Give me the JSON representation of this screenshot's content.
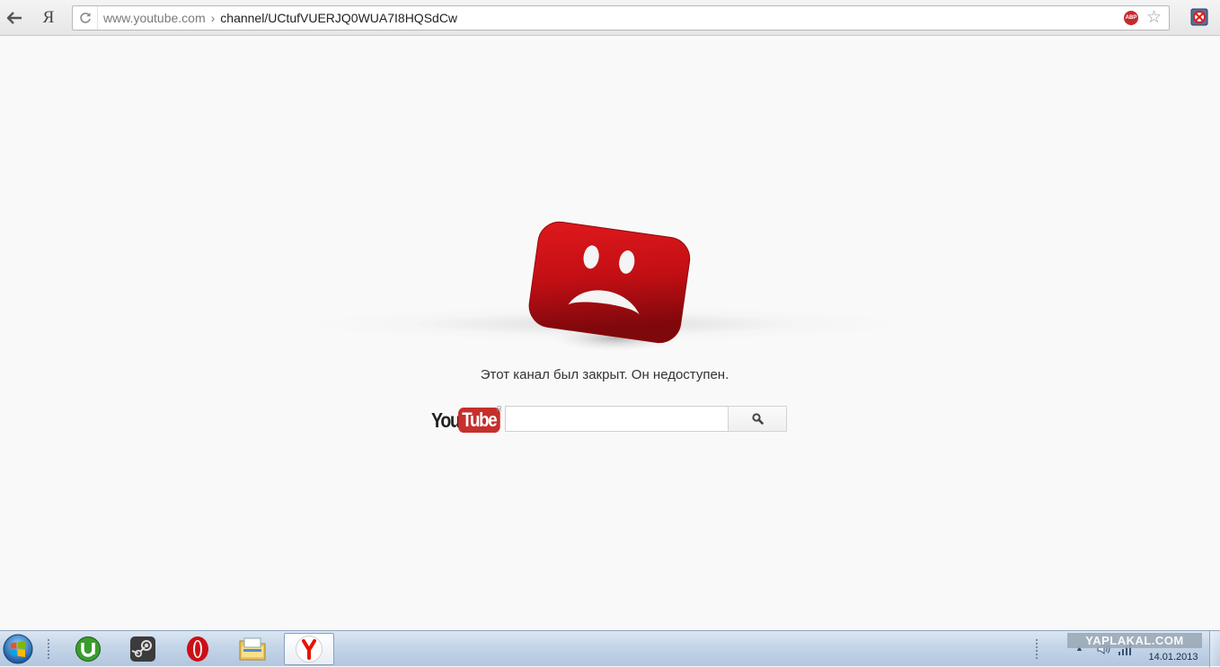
{
  "browser": {
    "address_host": "www.youtube.com",
    "address_separator": "›",
    "address_path": "channel/UCtufVUERJQ0WUA7I8HQSdCw",
    "yandex_button_label": "Я",
    "abp_label": "ABP"
  },
  "page": {
    "message": "Этот канал был закрыт. Он недоступен.",
    "logo_you": "You",
    "logo_tube": "Tube",
    "logo_r": "R",
    "search_value": "",
    "search_placeholder": ""
  },
  "taskbar": {
    "apps": [
      "utorrent-icon",
      "steam-icon",
      "opera-icon",
      "explorer-icon",
      "yandex-browser-icon"
    ],
    "active_app": "yandex-browser-icon",
    "watermark": "YAPLAKAL.COM",
    "date": "14.01.2013"
  },
  "colors": {
    "youtube_red": "#c4302b",
    "page_background": "#f9f9f9"
  }
}
